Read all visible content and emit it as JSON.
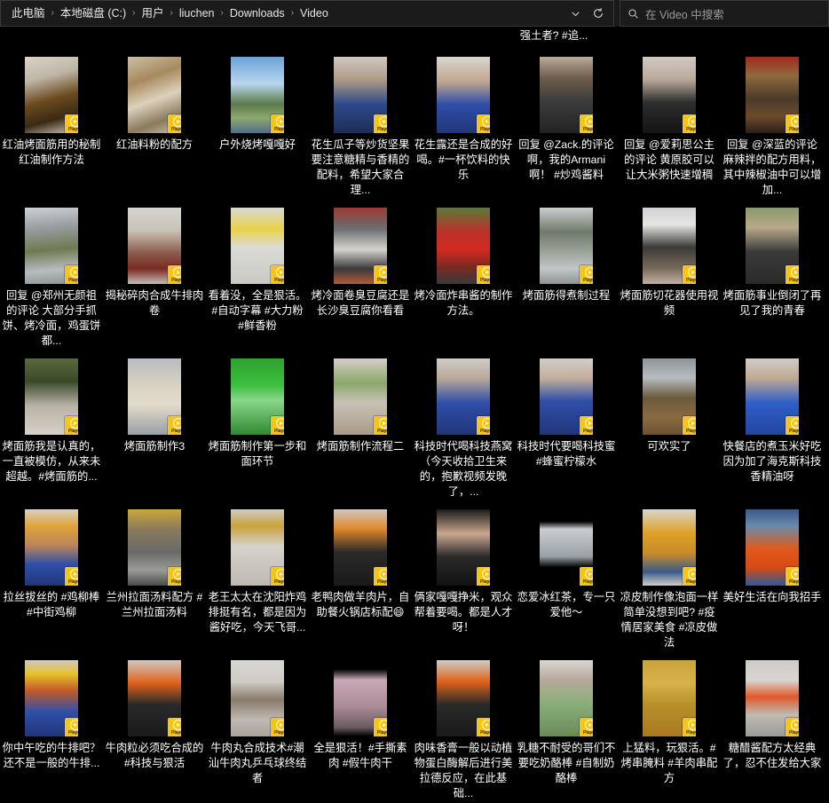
{
  "window": {
    "breadcrumb": {
      "items": [
        "此电脑",
        "本地磁盘 (C:)",
        "用户",
        "liuchen",
        "Downloads",
        "Video"
      ],
      "separator": "›"
    },
    "history_dropdown_icon": "chevron-down-icon",
    "refresh_icon": "refresh-icon",
    "search": {
      "icon": "search-icon",
      "placeholder": "在 Video 中搜索",
      "value": ""
    }
  },
  "clipped_row": {
    "partial_label": "强土者?  #追..."
  },
  "badge": {
    "label": "Player",
    "icon": "play-icon",
    "color": "#f5c518"
  },
  "files": [
    {
      "name": "红油烤面筋用的秘制红油制作方法",
      "thumb": "linear-gradient(165deg,#d8d2c8 0%,#bfb6a6 28%,#6b4a1f 55%,#3a2a14 78%,#cfc6b8 100%)"
    },
    {
      "name": "红油料粉的配方",
      "thumb": "linear-gradient(160deg,#cbbfa6 0%,#a8895e 30%,#dcd2bd 55%,#8a7a5e 80%,#c9bfa8 100%)"
    },
    {
      "name": "户外烧烤嘎嘎好",
      "thumb": "linear-gradient(180deg,#6ba3d8 0%,#b9d6ee 35%,#5d7a4a 62%,#8ea86e 80%,#4f6f8e 100%)"
    },
    {
      "name": "花生瓜子等炒货坚果要注意糖精与香精的配料，希望大家合理...",
      "thumb": "linear-gradient(180deg,#cfc9c2 0%,#b09a86 30%,#2f4a8a 62%,#1d2c54 100%)"
    },
    {
      "name": "花生露还是合成的好喝。#一杯饮料的快乐",
      "thumb": "linear-gradient(180deg,#d9d5d0 0%,#c2a78f 32%,#2f4fa8 62%,#22357a 100%)"
    },
    {
      "name": "回复 @Zack.的评论  啊，我的Armani啊！ #炒鸡酱料",
      "thumb": "linear-gradient(180deg,#b9aa9a 0%,#6e5c4c 28%,#3c3c3c 58%,#232323 100%)"
    },
    {
      "name": "回复 @爱莉思公主的评论 黄原胶可以让大米粥快速增稠",
      "thumb": "linear-gradient(180deg,#cfcac4 0%,#b9a898 30%,#2e2e2e 60%,#141414 100%)"
    },
    {
      "name": "回复 @深蓝的评论 麻辣拌的配方用料，其中辣椒油中可以增加...",
      "thumb": "linear-gradient(180deg,#a32a20 0%,#8e6a3c 25%,#4a3a2a 55%,#6b4a2a 78%,#2a2018 100%)"
    },
    {
      "name": "回复 @郑州无颜祖的评论 大部分手抓饼、烤冷面，鸡蛋饼都...",
      "thumb": "linear-gradient(175deg,#cfd2d4 0%,#9aa0a4 25%,#6f7a52 55%,#b8bcbe 80%,#8c9296 100%)"
    },
    {
      "name": "揭秘碎肉合成牛排肉卷",
      "thumb": "linear-gradient(180deg,#d6d4cf 0%,#c9c3b6 30%,#8a5a4a 60%,#7a2a22 80%,#c2bcb2 100%)"
    },
    {
      "name": "看着没，全是狠活。#自动字幕 #大力粉 #鲜香粉",
      "thumb": "linear-gradient(180deg,#d9d9d4 0%,#e8d24a 28%,#dcdcd6 52%,#c9c9c2 100%)"
    },
    {
      "name": "烤冷面卷臭豆腐还是长沙臭豆腐你看看",
      "thumb": "linear-gradient(180deg,#9a3a30 0%,#6b6f72 28%,#d6d2cc 55%,#3a3a3a 80%,#b25a3a 100%)"
    },
    {
      "name": "烤冷面炸串酱的制作方法。",
      "thumb": "linear-gradient(180deg,#5a7a3a 0%,#b8332a 30%,#d22a20 55%,#7a2a22 78%,#3a3a3a 100%)"
    },
    {
      "name": "烤面筋得煮制过程",
      "thumb": "linear-gradient(180deg,#c9cdd0 0%,#6f7a6a 32%,#9aa49a 58%,#c2c6c8 80%,#8e9294 100%)"
    },
    {
      "name": "烤面筋切花器使用视频",
      "thumb": "linear-gradient(180deg,#cfd2d4 0%,#e6e6e2 22%,#3a3a3a 52%,#7a6a5a 80%,#bfb2a2 100%)"
    },
    {
      "name": "烤面筋事业倒闭了再见了我的青春",
      "thumb": "linear-gradient(180deg,#8a9a6a 0%,#b9a88a 26%,#3a3a3a 58%,#2a2a2a 100%)"
    },
    {
      "name": "烤面筋我是认真的，一直被模仿，从来未超越。#烤面筋的...",
      "thumb": "linear-gradient(180deg,#5a6a3a 0%,#3a4a2a 30%,#b9b2a6 62%,#d6d2ca 100%)"
    },
    {
      "name": "烤面筋制作3",
      "thumb": "linear-gradient(180deg,#b8bcc0 0%,#d8d2c2 35%,#e2dccc 60%,#9aa0a4 100%)"
    },
    {
      "name": "烤面筋制作第一步和面环节",
      "thumb": "linear-gradient(180deg,#2fa02f 0%,#3cbf3c 35%,#8ad68a 55%,#2f8a2f 100%)"
    },
    {
      "name": "烤面筋制作流程二",
      "thumb": "linear-gradient(180deg,#d8cec6 0%,#8aa86a 32%,#c9c2b6 58%,#a89a8a 100%)"
    },
    {
      "name": "科技时代喝科技燕窝 （今天收拾卫生来的，抱歉视频发晚了，...",
      "thumb": "linear-gradient(180deg,#cfcdc8 0%,#b9a898 26%,#2f4fa8 58%,#22357a 100%)"
    },
    {
      "name": "科技时代要喝科技蜜 #蜂蜜柠檬水",
      "thumb": "linear-gradient(180deg,#d2cec8 0%,#c2ae9a 26%,#2f4fa8 56%,#22357a 100%)"
    },
    {
      "name": "可欢实了",
      "thumb": "linear-gradient(180deg,#8e9498 0%,#b8bcc0 25%,#6b5a3a 52%,#8a6a42 78%,#6a5230 100%)"
    },
    {
      "name": "快餐店的煮玉米好吃因为加了海克斯科技香精油呀",
      "thumb": "linear-gradient(180deg,#cfcdc8 0%,#bfa892 26%,#2f5fc8 58%,#2444a0 100%)"
    },
    {
      "name": "拉丝拔丝的 #鸡柳棒 #中街鸡柳",
      "thumb": "linear-gradient(180deg,#d8d2c2 0%,#e0a23a 22%,#b8835a 48%,#2f4fa8 72%,#22357a 100%)"
    },
    {
      "name": "兰州拉面汤料配方 #兰州拉面汤料",
      "thumb": "linear-gradient(180deg,#c9a83a 0%,#8a7a5a 26%,#6a6a6a 56%,#9a9a96 80%,#4a4a4a 100%)"
    },
    {
      "name": "老王太太在沈阳炸鸡排挺有名，都是因为酱好吃，今天飞哥...",
      "thumb": "linear-gradient(180deg,#cfccc6 0%,#c9a23a 22%,#d6d2cc 48%,#bfbab2 100%)"
    },
    {
      "name": "老鸭肉做羊肉片，自助餐火锅店标配😄",
      "thumb": "linear-gradient(180deg,#cfc9c2 0%,#e0862a 26%,#2a2a2a 56%,#1a1a1a 100%)"
    },
    {
      "name": "俩家嘎嘎挣米，观众帮着要喝。都是人才呀！",
      "thumb": "linear-gradient(180deg,#1a1a1a 0%,#caa78e 32%,#2a2a2a 62%,#121212 100%)"
    },
    {
      "name": "恋爱冰红茶，专一只爱他～",
      "thumb": "linear-gradient(180deg,#000000 0%,#000000 16%,#c9cdd0 26%,#9aa0a4 62%,#000000 76%,#000000 100%)"
    },
    {
      "name": "凉皮制作像泡面一样简单没想到吧? #疫情居家美食 #凉皮做法",
      "thumb": "linear-gradient(180deg,#d8d6d2 0%,#e0a22a 30%,#c98a2a 58%,#3a5a8a 82%,#d2cec8 100%)"
    },
    {
      "name": "美好生活在向我招手",
      "thumb": "linear-gradient(180deg,#3a5a8a 0%,#6a8aaa 22%,#e05a1a 52%,#d84a14 76%,#2a5a9a 100%)"
    },
    {
      "name": "你中午吃的牛排吧？还不是一般的牛排...",
      "thumb": "linear-gradient(180deg,#cfc9c2 0%,#e6c22a 18%,#c25a2a 40%,#2f4fa8 68%,#22357a 100%)"
    },
    {
      "name": "牛肉粒必须吃合成的 #科技与狠活",
      "thumb": "linear-gradient(180deg,#cfc9c2 0%,#e0621a 30%,#2a2a2a 58%,#1a1a1a 100%)"
    },
    {
      "name": "牛肉丸合成技术#潮汕牛肉丸乒乓球终结者",
      "thumb": "linear-gradient(180deg,#d8d6d2 0%,#cfccc6 28%,#8a7a6a 52%,#bfbab4 78%,#a8a29a 100%)"
    },
    {
      "name": "全是狠活！#手撕素肉 #假牛肉干",
      "thumb": "linear-gradient(180deg,#000000 0%,#000000 12%,#c9a8b8 26%,#a88a96 62%,#6a5a62 88%,#000000 100%)"
    },
    {
      "name": "肉味香膏一般以动植物蛋白酶解后进行美拉德反应，在此基础...",
      "thumb": "linear-gradient(180deg,#cfcdc8 0%,#e0621a 28%,#2a2a2a 58%,#1a1a1a 100%)"
    },
    {
      "name": "乳糖不耐受的哥们不要吃奶酪棒 #自制奶酪棒",
      "thumb": "linear-gradient(180deg,#d8d6d2 0%,#b8a89a 26%,#8ab07a 56%,#6a8a5a 100%)"
    },
    {
      "name": "上猛料，玩狠活。#烤串腌料 #羊肉串配方",
      "thumb": "linear-gradient(180deg,#c9a23a 0%,#d8b24a 30%,#b8902a 58%,#a87a20 100%)"
    },
    {
      "name": "糖醋酱配方太经典了，忍不住发给大家",
      "thumb": "linear-gradient(180deg,#cfccc6 0%,#d8d6d2 26%,#e05a2a 48%,#bfbab4 72%,#9a9a96 100%)"
    }
  ]
}
